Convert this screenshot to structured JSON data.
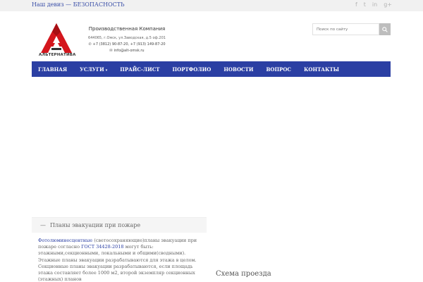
{
  "topbar": {
    "motto": "Наш девиз — БЕЗОПАСНОСТЬ",
    "social": [
      {
        "icon": "facebook-icon",
        "glyph": "f"
      },
      {
        "icon": "twitter-icon",
        "glyph": "t"
      },
      {
        "icon": "linkedin-icon",
        "glyph": "in"
      },
      {
        "icon": "google-plus-icon",
        "glyph": "g+"
      }
    ]
  },
  "logo": {
    "text": "АЛЬТЕРНАТИВА",
    "color": "#d4161d"
  },
  "company": {
    "name": "Производственная Компания",
    "address": "644065, г.Омск, ул.Заводская, д.5 оф.201",
    "phone": "+7 (3812) 90-87-20, +7 (913) 149-87-20",
    "email": "info@alt-omsk.ru"
  },
  "search": {
    "placeholder": "Поиск по сайту"
  },
  "nav": {
    "color": "#2b3fa3",
    "items": [
      "ГЛАВНАЯ",
      "УСЛУГИ",
      "ПРАЙС-ЛИСТ",
      "ПОРТФОЛИО",
      "НОВОСТИ",
      "ВОПРОС",
      "КОНТАКТЫ"
    ]
  },
  "accordion": {
    "title": "Планы эвакуации при пожаре",
    "link1": "Фотолюминесцентные",
    "text1": " (светосохраняющие)планы эвакуации при пожаре согласно ",
    "link2": "ГОСТ 34428-2018",
    "text2": "  могут быть: этажными,секционными, локальными и общими(сводными). Этажные планы эвакуации разрабатываются для этажа в целом. Секционные планы эвакуации разрабатываются, если площадь этажа составляет более 1000 м2, второй экземпляр секционных (этажных) планов"
  },
  "scheme": {
    "title": "Схема проезда"
  }
}
